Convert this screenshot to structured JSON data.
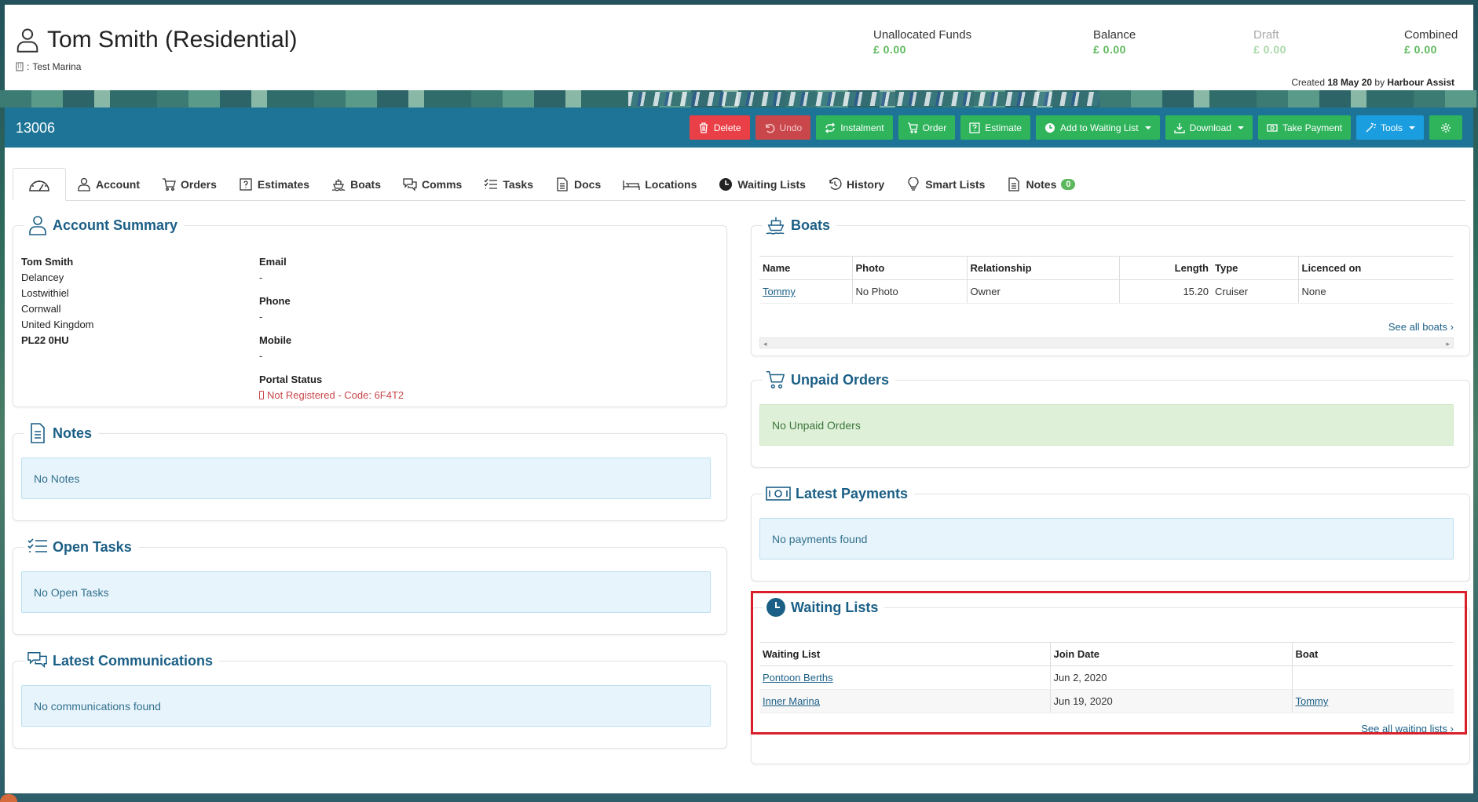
{
  "header": {
    "name": "Tom Smith (Residential)",
    "marina_prefix": ": ",
    "marina": "Test Marina",
    "stats": [
      {
        "label": "Unallocated Funds",
        "value": "£ 0.00"
      },
      {
        "label": "Balance",
        "value": "£ 0.00"
      },
      {
        "label": "Draft",
        "value": "£ 0.00"
      },
      {
        "label": "Combined",
        "value": "£ 0.00"
      }
    ],
    "created_prefix": "Created ",
    "created_date": "18 May 20",
    "created_by_prefix": " by ",
    "created_by": "Harbour Assist"
  },
  "toolbar": {
    "account_number": "13006",
    "delete": "Delete",
    "undo": "Undo",
    "instalment": "Instalment",
    "order": "Order",
    "estimate": "Estimate",
    "add_waiting_list": "Add to Waiting List",
    "download": "Download",
    "take_payment": "Take Payment",
    "tools": "Tools"
  },
  "tabs": {
    "account": "Account",
    "orders": "Orders",
    "estimates": "Estimates",
    "boats": "Boats",
    "comms": "Comms",
    "tasks": "Tasks",
    "docs": "Docs",
    "locations": "Locations",
    "waiting_lists": "Waiting Lists",
    "history": "History",
    "smart_lists": "Smart Lists",
    "notes": "Notes",
    "notes_count": "0"
  },
  "account_summary": {
    "title": "Account Summary",
    "name": "Tom Smith",
    "address": [
      "Delancey",
      "Lostwithiel",
      "Cornwall",
      "United Kingdom"
    ],
    "postcode": "PL22 0HU",
    "email_label": "Email",
    "email": "-",
    "phone_label": "Phone",
    "phone": "-",
    "mobile_label": "Mobile",
    "mobile": "-",
    "portal_label": "Portal Status",
    "portal_status": "Not Registered - Code: 6F4T2"
  },
  "notes": {
    "title": "Notes",
    "empty": "No Notes"
  },
  "open_tasks": {
    "title": "Open Tasks",
    "empty": "No Open Tasks"
  },
  "latest_comms": {
    "title": "Latest Communications",
    "empty": "No communications found"
  },
  "boats": {
    "title": "Boats",
    "headers": [
      "Name",
      "Photo",
      "Relationship",
      "Length",
      "Type",
      "Licenced on"
    ],
    "rows": [
      [
        "Tommy",
        "No Photo",
        "Owner",
        "15.20",
        "Cruiser",
        "None"
      ]
    ],
    "see_all": "See all boats"
  },
  "unpaid_orders": {
    "title": "Unpaid Orders",
    "empty": "No Unpaid Orders"
  },
  "latest_payments": {
    "title": "Latest Payments",
    "empty": "No payments found"
  },
  "waiting_lists": {
    "title": "Waiting Lists",
    "headers": [
      "Waiting List",
      "Join Date",
      "Boat"
    ],
    "rows": [
      [
        "Pontoon Berths",
        "Jun 2, 2020",
        ""
      ],
      [
        "Inner Marina",
        "Jun 19, 2020",
        "Tommy"
      ]
    ],
    "see_all": "See all waiting lists"
  },
  "colors": {
    "primary": "#1d7496",
    "success": "#2fb45c",
    "danger": "#e94047",
    "info": "#1b9ee0",
    "highlight": "#d9202a"
  }
}
